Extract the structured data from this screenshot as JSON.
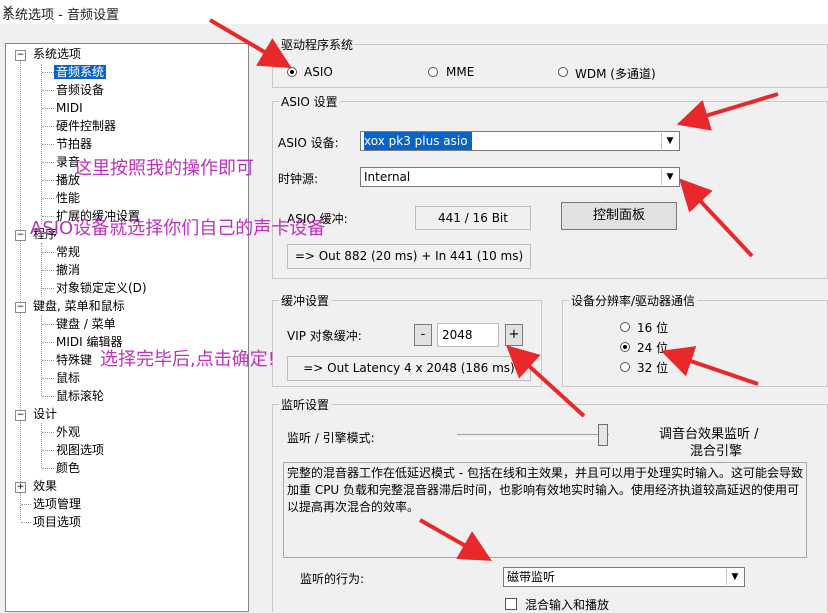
{
  "window": {
    "title": "系统选项 - 音频设置",
    "close_glyph": "×"
  },
  "tree": {
    "system": "系统选项",
    "system_items": [
      "音频系统",
      "音频设备",
      "MIDI",
      "硬件控制器",
      "节拍器",
      "录音",
      "播放",
      "性能",
      "扩展的缓冲设置"
    ],
    "program": "程序",
    "program_items": [
      "常规",
      "撤消",
      "对象锁定定义(D)"
    ],
    "keyboard": "键盘, 菜单和鼠标",
    "keyboard_items": [
      "键盘 / 菜单",
      "MIDI 编辑器",
      "特殊键",
      "鼠标",
      "鼠标滚轮"
    ],
    "design": "设计",
    "design_items": [
      "外观",
      "视图选项",
      "颜色"
    ],
    "effects": "效果",
    "option_manage": "选项管理",
    "project_options": "项目选项",
    "expander_minus": "−",
    "expander_plus": "+"
  },
  "driver": {
    "group_label": "驱动程序系统",
    "options": [
      "ASIO",
      "MME",
      "WDM (多通道)"
    ],
    "selected": "ASIO"
  },
  "asio": {
    "group_label": "ASIO 设置",
    "device_label": "ASIO 设备:",
    "device_value": "xox pk3 plus asio",
    "clock_label": "时钟源:",
    "clock_value": "Internal",
    "buffer_label": "ASIO 缓冲:",
    "buffer_value": "441 / 16 Bit",
    "control_panel": "控制面板",
    "latency_info": "=> Out 882 (20 ms) + In 441 (10 ms)"
  },
  "buffer": {
    "group_label": "缓冲设置",
    "vip_label": "VIP 对象缓冲:",
    "minus": "-",
    "value": "2048",
    "plus": "+",
    "latency_info": "=> Out Latency 4 x 2048 (186 ms)"
  },
  "resolution": {
    "group_label": "设备分辨率/驱动器通信",
    "options": [
      "16 位",
      "24 位",
      "32 位"
    ],
    "selected": "24 位"
  },
  "monitor": {
    "group_label": "监听设置",
    "mode_label": "监听 / 引擎模式:",
    "right_label_1": "调音台效果监听 /",
    "right_label_2": "混合引擎",
    "slider_level": 1.0,
    "description": "完整的混音器工作在低延迟模式 - 包括在线和主效果，并且可以用于处理实时输入。这可能会导致加重 CPU 负载和完整混音器滞后时间，也影响有效地实时输入。使用经济执道较高延迟的使用可以提高再次混合的效率。",
    "behavior_label": "监听的行为:",
    "behavior_value": "磁带监听",
    "mix_checkbox": "混合输入和播放",
    "mix_checked": false
  },
  "annotations": {
    "text1": "这里按照我的操作即可",
    "text2": "ASIO设备就选择你们自己的声卡设备",
    "text3": "选择完毕后,点击确定!",
    "color": "#c030c0",
    "arrow_color": "#e8282a"
  },
  "colors": {
    "selection": "#0a64c8",
    "background": "#f0f0f0"
  }
}
